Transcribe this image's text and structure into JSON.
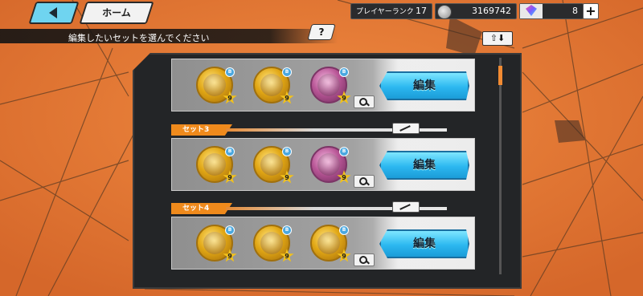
{
  "top_bar": {
    "home_label": "ホーム",
    "rank_label": "プレイヤーランク",
    "rank_value": "17",
    "coins": "3169742",
    "gems": "8",
    "plus_label": "+"
  },
  "instruction": "編集したいセットを選んでください",
  "help_label": "?",
  "sort_label": "⇧⬇",
  "sets": [
    {
      "name": "",
      "edit_label": "編集",
      "medals": [
        {
          "type": "gold",
          "level": "9"
        },
        {
          "type": "gold",
          "level": "9"
        },
        {
          "type": "pink",
          "level": "9"
        }
      ]
    },
    {
      "name": "セット3",
      "edit_label": "編集",
      "medals": [
        {
          "type": "gold",
          "level": "9"
        },
        {
          "type": "gold",
          "level": "9"
        },
        {
          "type": "pink",
          "level": "9"
        }
      ]
    },
    {
      "name": "セット4",
      "edit_label": "編集",
      "medals": [
        {
          "type": "gold",
          "level": "9"
        },
        {
          "type": "gold",
          "level": "9"
        },
        {
          "type": "gold",
          "level": "9"
        }
      ]
    }
  ],
  "colors": {
    "accent": "#f28b32",
    "edit_button": "#2cb8f0",
    "background": "#e07a35"
  }
}
